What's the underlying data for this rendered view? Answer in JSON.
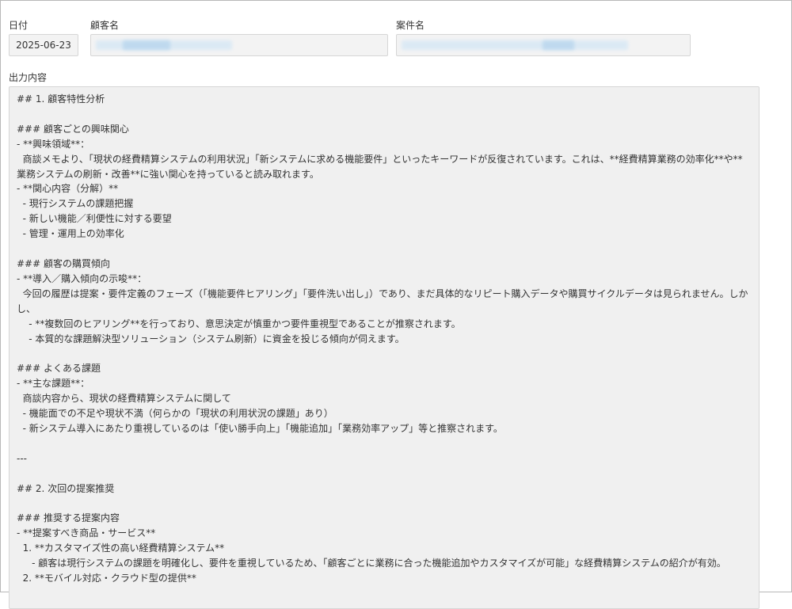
{
  "form": {
    "date_label": "日付",
    "date_value": "2025-06-23",
    "customer_label": "顧客名",
    "customer_value": "",
    "project_label": "案件名",
    "project_value": "",
    "output_label": "出力内容"
  },
  "colors": {
    "redaction_light": "#d9e9f5",
    "redaction_mid": "#bcd8ee"
  },
  "output": {
    "lines": [
      "## 1. 顧客特性分析",
      "",
      "### 顧客ごとの興味関心",
      "- **興味領域**：",
      "  商談メモより、「現状の経費精算システムの利用状況」「新システムに求める機能要件」といったキーワードが反復されています。これは、**経費精算業務の効率化**や**業務システムの刷新・改善**に強い関心を持っていると読み取れます。",
      "- **関心内容（分解）**",
      "  - 現行システムの課題把握",
      "  - 新しい機能／利便性に対する要望",
      "  - 管理・運用上の効率化",
      "",
      "### 顧客の購買傾向",
      "- **導入／購入傾向の示唆**：",
      "  今回の履歴は提案・要件定義のフェーズ（「機能要件ヒアリング」「要件洗い出し」）であり、まだ具体的なリピート購入データや購買サイクルデータは見られません。しかし、",
      "    - **複数回のヒアリング**を行っており、意思決定が慎重かつ要件重視型であることが推察されます。",
      "    - 本質的な課題解決型ソリューション（システム刷新）に資金を投じる傾向が伺えます。",
      "",
      "### よくある課題",
      "- **主な課題**：",
      "  商談内容から、現状の経費精算システムに関して",
      "  - 機能面での不足や現状不満（何らかの「現状の利用状況の課題」あり）",
      "  - 新システム導入にあたり重視しているのは「使い勝手向上」「機能追加」「業務効率アップ」等と推察されます。",
      "",
      "---",
      "",
      "## 2. 次回の提案推奨",
      "",
      "### 推奨する提案内容",
      "- **提案すべき商品・サービス**",
      "  1. **カスタマイズ性の高い経費精算システム**",
      "     - 顧客は現行システムの課題を明確化し、要件を重視しているため、「顧客ごとに業務に合った機能追加やカスタマイズが可能」な経費精算システムの紹介が有効。",
      "  2. **モバイル対応・クラウド型の提供**"
    ]
  }
}
